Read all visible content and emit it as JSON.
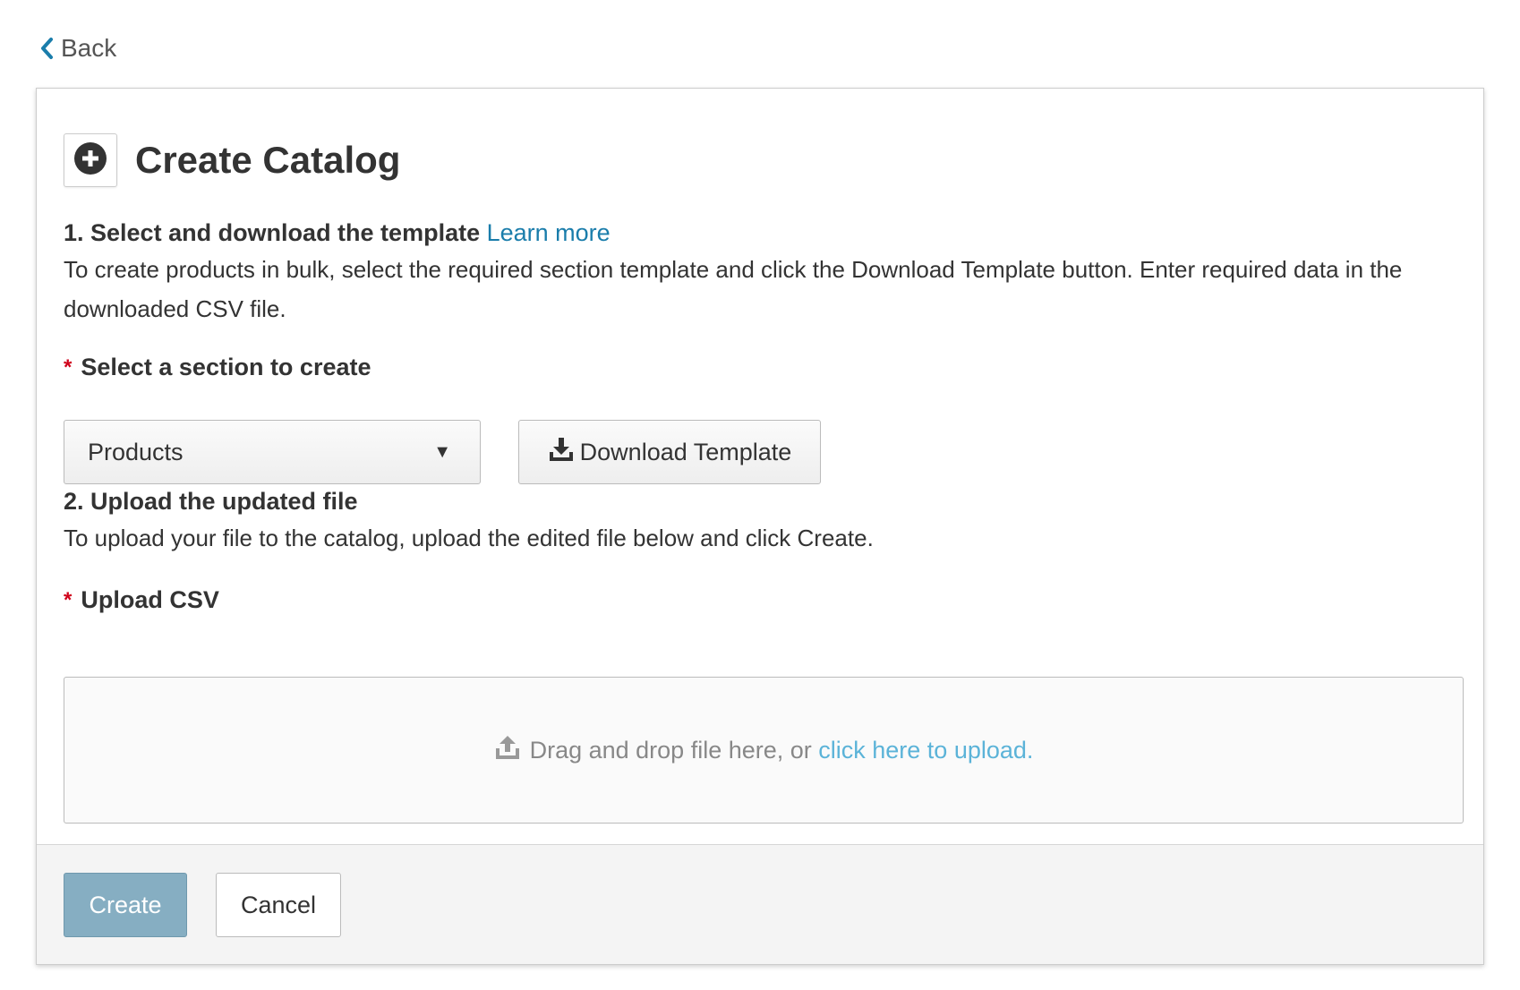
{
  "nav": {
    "back_label": "Back",
    "back_icon": "chevron-left-icon"
  },
  "header": {
    "title": "Create Catalog",
    "icon": "plus-circle-icon"
  },
  "step1": {
    "heading": "1. Select and download the template",
    "learn_more": "Learn more",
    "description": "To create products in bulk, select the required section template and click the Download Template button. Enter required data in the downloaded CSV file."
  },
  "section_field": {
    "required_mark": "*",
    "label": "Select a section to create",
    "selected_value": "Products",
    "caret": "▼"
  },
  "download_button": {
    "label": "Download Template",
    "icon": "download-icon"
  },
  "step2": {
    "heading": "2. Upload the updated file",
    "description": "To upload your file to the catalog, upload the edited file below and click Create."
  },
  "upload_field": {
    "required_mark": "*",
    "label": "Upload CSV",
    "drop_text": "Drag and drop file here, or ",
    "upload_link": "click here to upload.",
    "icon": "upload-icon"
  },
  "footer": {
    "create_label": "Create",
    "cancel_label": "Cancel"
  },
  "colors": {
    "link": "#1a7dab",
    "upload_link": "#5bb3d8",
    "required": "#d0021b",
    "primary_button": "#86aec2",
    "footer_bg": "#f4f4f4"
  }
}
